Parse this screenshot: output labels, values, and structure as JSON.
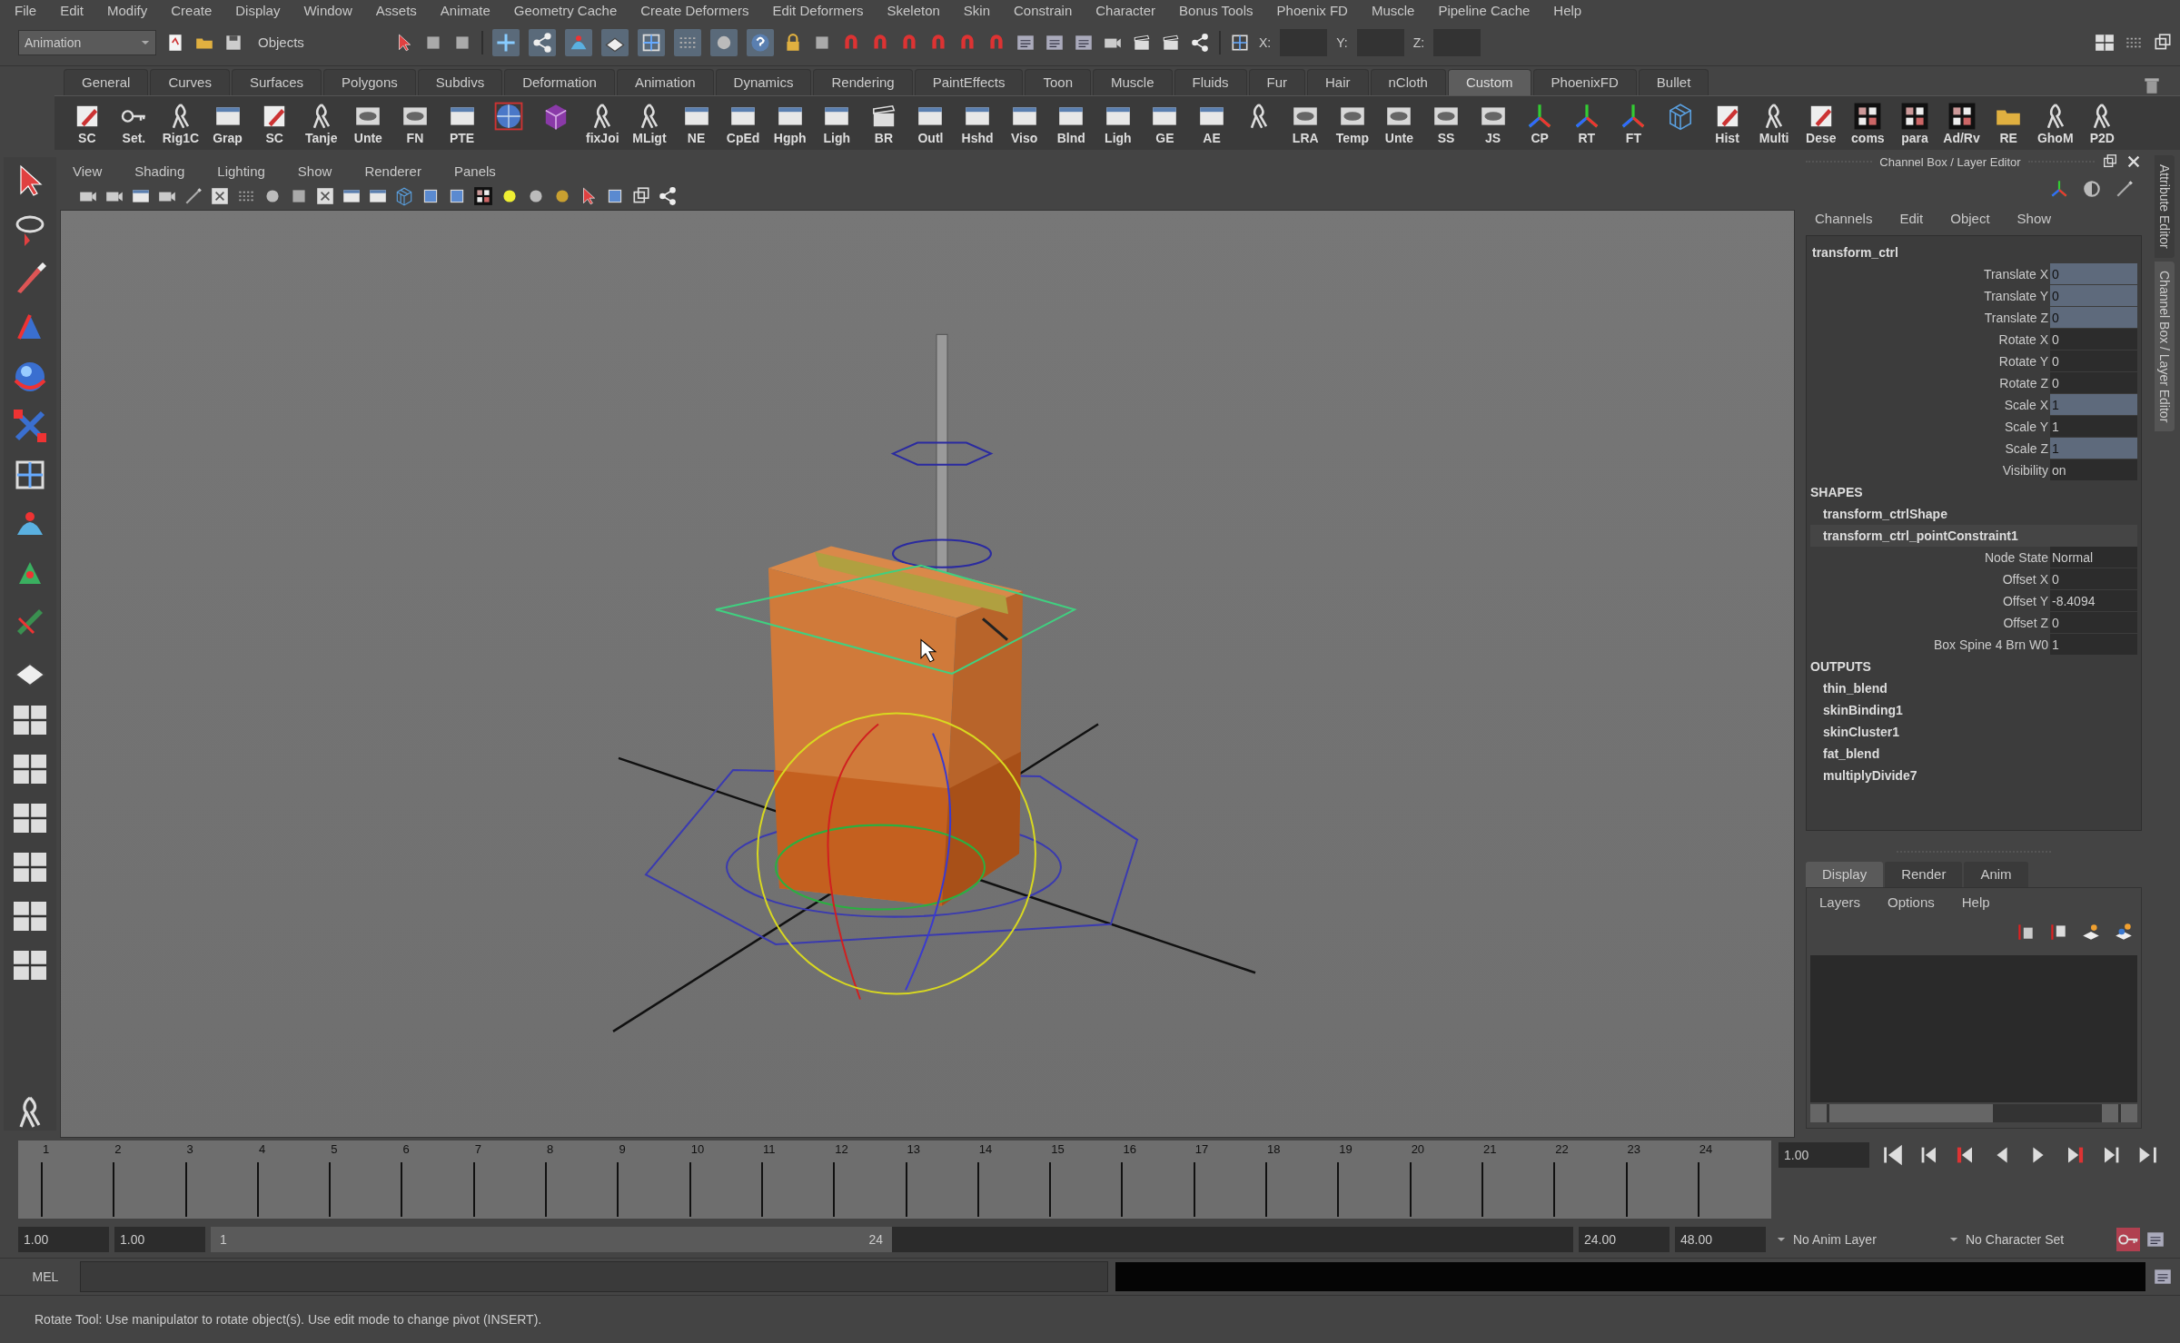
{
  "menu_bar": [
    "File",
    "Edit",
    "Modify",
    "Create",
    "Display",
    "Window",
    "Assets",
    "Animate",
    "Geometry Cache",
    "Create Deformers",
    "Edit Deformers",
    "Skeleton",
    "Skin",
    "Constrain",
    "Character",
    "Bonus Tools",
    "Phoenix FD",
    "Muscle",
    "Pipeline Cache",
    "Help"
  ],
  "status_line": {
    "menu_set": "Animation",
    "selection_mode": "Objects",
    "coord_labels": [
      "X:",
      "Y:",
      "Z:"
    ]
  },
  "shelf_tabs": [
    {
      "label": "General",
      "selected": false
    },
    {
      "label": "Curves",
      "selected": false
    },
    {
      "label": "Surfaces",
      "selected": false
    },
    {
      "label": "Polygons",
      "selected": false
    },
    {
      "label": "Subdivs",
      "selected": false
    },
    {
      "label": "Deformation",
      "selected": false
    },
    {
      "label": "Animation",
      "selected": false
    },
    {
      "label": "Dynamics",
      "selected": false
    },
    {
      "label": "Rendering",
      "selected": false
    },
    {
      "label": "PaintEffects",
      "selected": false
    },
    {
      "label": "Toon",
      "selected": false
    },
    {
      "label": "Muscle",
      "selected": false
    },
    {
      "label": "Fluids",
      "selected": false
    },
    {
      "label": "Fur",
      "selected": false
    },
    {
      "label": "Hair",
      "selected": false
    },
    {
      "label": "nCloth",
      "selected": false
    },
    {
      "label": "Custom",
      "selected": true
    },
    {
      "label": "PhoenixFD",
      "selected": false
    },
    {
      "label": "Bullet",
      "selected": false
    }
  ],
  "shelf_items": [
    {
      "kind": "pencil",
      "label": "SC"
    },
    {
      "kind": "key",
      "label": "Set."
    },
    {
      "kind": "figure",
      "label": "Rig1C"
    },
    {
      "kind": "window",
      "label": "Grap"
    },
    {
      "kind": "pencil",
      "label": "SC"
    },
    {
      "kind": "figure",
      "label": "Tanje"
    },
    {
      "kind": "eye",
      "label": "Unte"
    },
    {
      "kind": "eye",
      "label": "FN"
    },
    {
      "kind": "window",
      "label": "PTE"
    },
    {
      "kind": "sphere"
    },
    {
      "kind": "cube"
    },
    {
      "kind": "figure",
      "label": "fixJoi"
    },
    {
      "kind": "figure",
      "label": "MLigt"
    },
    {
      "kind": "window",
      "label": "NE"
    },
    {
      "kind": "window",
      "label": "CpEd"
    },
    {
      "kind": "window",
      "label": "Hgph"
    },
    {
      "kind": "window",
      "label": "Ligh"
    },
    {
      "kind": "clapper",
      "label": "BR"
    },
    {
      "kind": "window",
      "label": "Outl"
    },
    {
      "kind": "window",
      "label": "Hshd"
    },
    {
      "kind": "window",
      "label": "Viso"
    },
    {
      "kind": "window",
      "label": "Blnd"
    },
    {
      "kind": "window",
      "label": "Ligh"
    },
    {
      "kind": "window",
      "label": "GE"
    },
    {
      "kind": "window",
      "label": "AE"
    },
    {
      "kind": "figure"
    },
    {
      "kind": "eye",
      "label": "LRA"
    },
    {
      "kind": "eye",
      "label": "Temp"
    },
    {
      "kind": "eye",
      "label": "Unte"
    },
    {
      "kind": "eye",
      "label": "SS"
    },
    {
      "kind": "eye",
      "label": "JS"
    },
    {
      "kind": "axes",
      "label": "CP"
    },
    {
      "kind": "axes",
      "label": "RT"
    },
    {
      "kind": "axes",
      "label": "FT"
    },
    {
      "kind": "wirecube"
    },
    {
      "kind": "pencil",
      "label": "Hist"
    },
    {
      "kind": "figure",
      "label": "Multi"
    },
    {
      "kind": "pencil",
      "label": "Dese"
    },
    {
      "kind": "swatch",
      "label": "coms"
    },
    {
      "kind": "swatch",
      "label": "para"
    },
    {
      "kind": "swatch",
      "label": "Ad/Rv"
    },
    {
      "kind": "folder",
      "label": "RE"
    },
    {
      "kind": "figure",
      "label": "GhoM"
    },
    {
      "kind": "figure",
      "label": "P2D"
    }
  ],
  "viewport": {
    "menu": [
      "View",
      "Shading",
      "Lighting",
      "Show",
      "Renderer",
      "Panels"
    ]
  },
  "channel_box": {
    "title": "Channel Box / Layer Editor",
    "menu": [
      "Channels",
      "Edit",
      "Object",
      "Show"
    ],
    "object": "transform_ctrl",
    "channels": [
      {
        "name": "Translate X",
        "value": "0",
        "selected": true
      },
      {
        "name": "Translate Y",
        "value": "0",
        "selected": true
      },
      {
        "name": "Translate Z",
        "value": "0",
        "selected": true
      },
      {
        "name": "Rotate X",
        "value": "0",
        "selected": false
      },
      {
        "name": "Rotate Y",
        "value": "0",
        "selected": false
      },
      {
        "name": "Rotate Z",
        "value": "0",
        "selected": false
      },
      {
        "name": "Scale X",
        "value": "1",
        "selected": true
      },
      {
        "name": "Scale Y",
        "value": "1",
        "selected": false
      },
      {
        "name": "Scale Z",
        "value": "1",
        "selected": true
      },
      {
        "name": "Visibility",
        "value": "on",
        "selected": false
      }
    ],
    "shapes_heading": "SHAPES",
    "shapes": [
      "transform_ctrlShape"
    ],
    "constraint": "transform_ctrl_pointConstraint1",
    "constraint_channels": [
      {
        "name": "Node State",
        "value": "Normal"
      },
      {
        "name": "Offset X",
        "value": "0"
      },
      {
        "name": "Offset Y",
        "value": "-8.4094"
      },
      {
        "name": "Offset Z",
        "value": "0"
      },
      {
        "name": "Box Spine 4 Brn W0",
        "value": "1"
      }
    ],
    "outputs_heading": "OUTPUTS",
    "outputs": [
      "thin_blend",
      "skinBinding1",
      "skinCluster1",
      "fat_blend",
      "multiplyDivide7"
    ]
  },
  "layer_editor": {
    "tabs": [
      {
        "label": "Display",
        "selected": true
      },
      {
        "label": "Render",
        "selected": false
      },
      {
        "label": "Anim",
        "selected": false
      }
    ],
    "menu": [
      "Layers",
      "Options",
      "Help"
    ]
  },
  "side_tabs": [
    {
      "label": "Attribute Editor",
      "selected": false
    },
    {
      "label": "Channel Box / Layer Editor",
      "selected": true
    }
  ],
  "time_slider": {
    "frames": [
      "1",
      "2",
      "3",
      "4",
      "5",
      "6",
      "7",
      "8",
      "9",
      "10",
      "11",
      "12",
      "13",
      "14",
      "15",
      "16",
      "17",
      "18",
      "19",
      "20",
      "21",
      "22",
      "23",
      "24"
    ],
    "current_time": "1.00"
  },
  "range_slider": {
    "level": 0.5,
    "start": "1.00",
    "playback_start": "1.00",
    "range_start": "1",
    "range_end": "24",
    "playback_end": "24.00",
    "end": "48.00",
    "anim_layer": "No Anim Layer",
    "character_set": "No Character Set"
  },
  "command_line": {
    "label": "MEL"
  },
  "help_line": "Rotate Tool: Use manipulator to rotate object(s). Use edit mode to change pivot (INSERT)."
}
